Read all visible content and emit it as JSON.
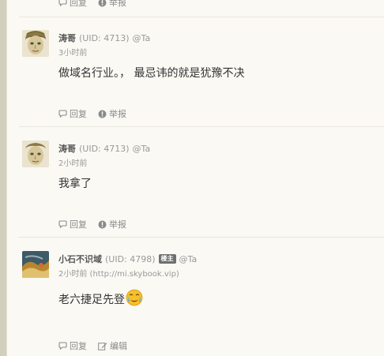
{
  "top_actions": {
    "reply": "回复",
    "report": "举报"
  },
  "posts": [
    {
      "author": "涛哥",
      "uid": "(UID: 4713)",
      "badge": "",
      "ta": "@Ta",
      "time": "3小时前",
      "content": "做域名行业。， 最忌讳的就是犹豫不决",
      "actions": {
        "reply": "回复",
        "second": "举报"
      }
    },
    {
      "author": "涛哥",
      "uid": "(UID: 4713)",
      "badge": "",
      "ta": "@Ta",
      "time": "2小时前",
      "content": "我拿了",
      "actions": {
        "reply": "回复",
        "second": "举报"
      }
    },
    {
      "author": "小石不识域",
      "uid": "(UID: 4798)",
      "badge": "楼主",
      "ta": "@Ta",
      "time": "2小时前 (http://mi.skybook.vip)",
      "content": "老六捷足先登",
      "actions": {
        "reply": "回复",
        "second": "编辑"
      }
    }
  ],
  "icons": {
    "reply": "comment-icon",
    "report": "exclamation-circle-icon",
    "edit": "edit-icon",
    "emoji": "crying-face-emoji"
  }
}
